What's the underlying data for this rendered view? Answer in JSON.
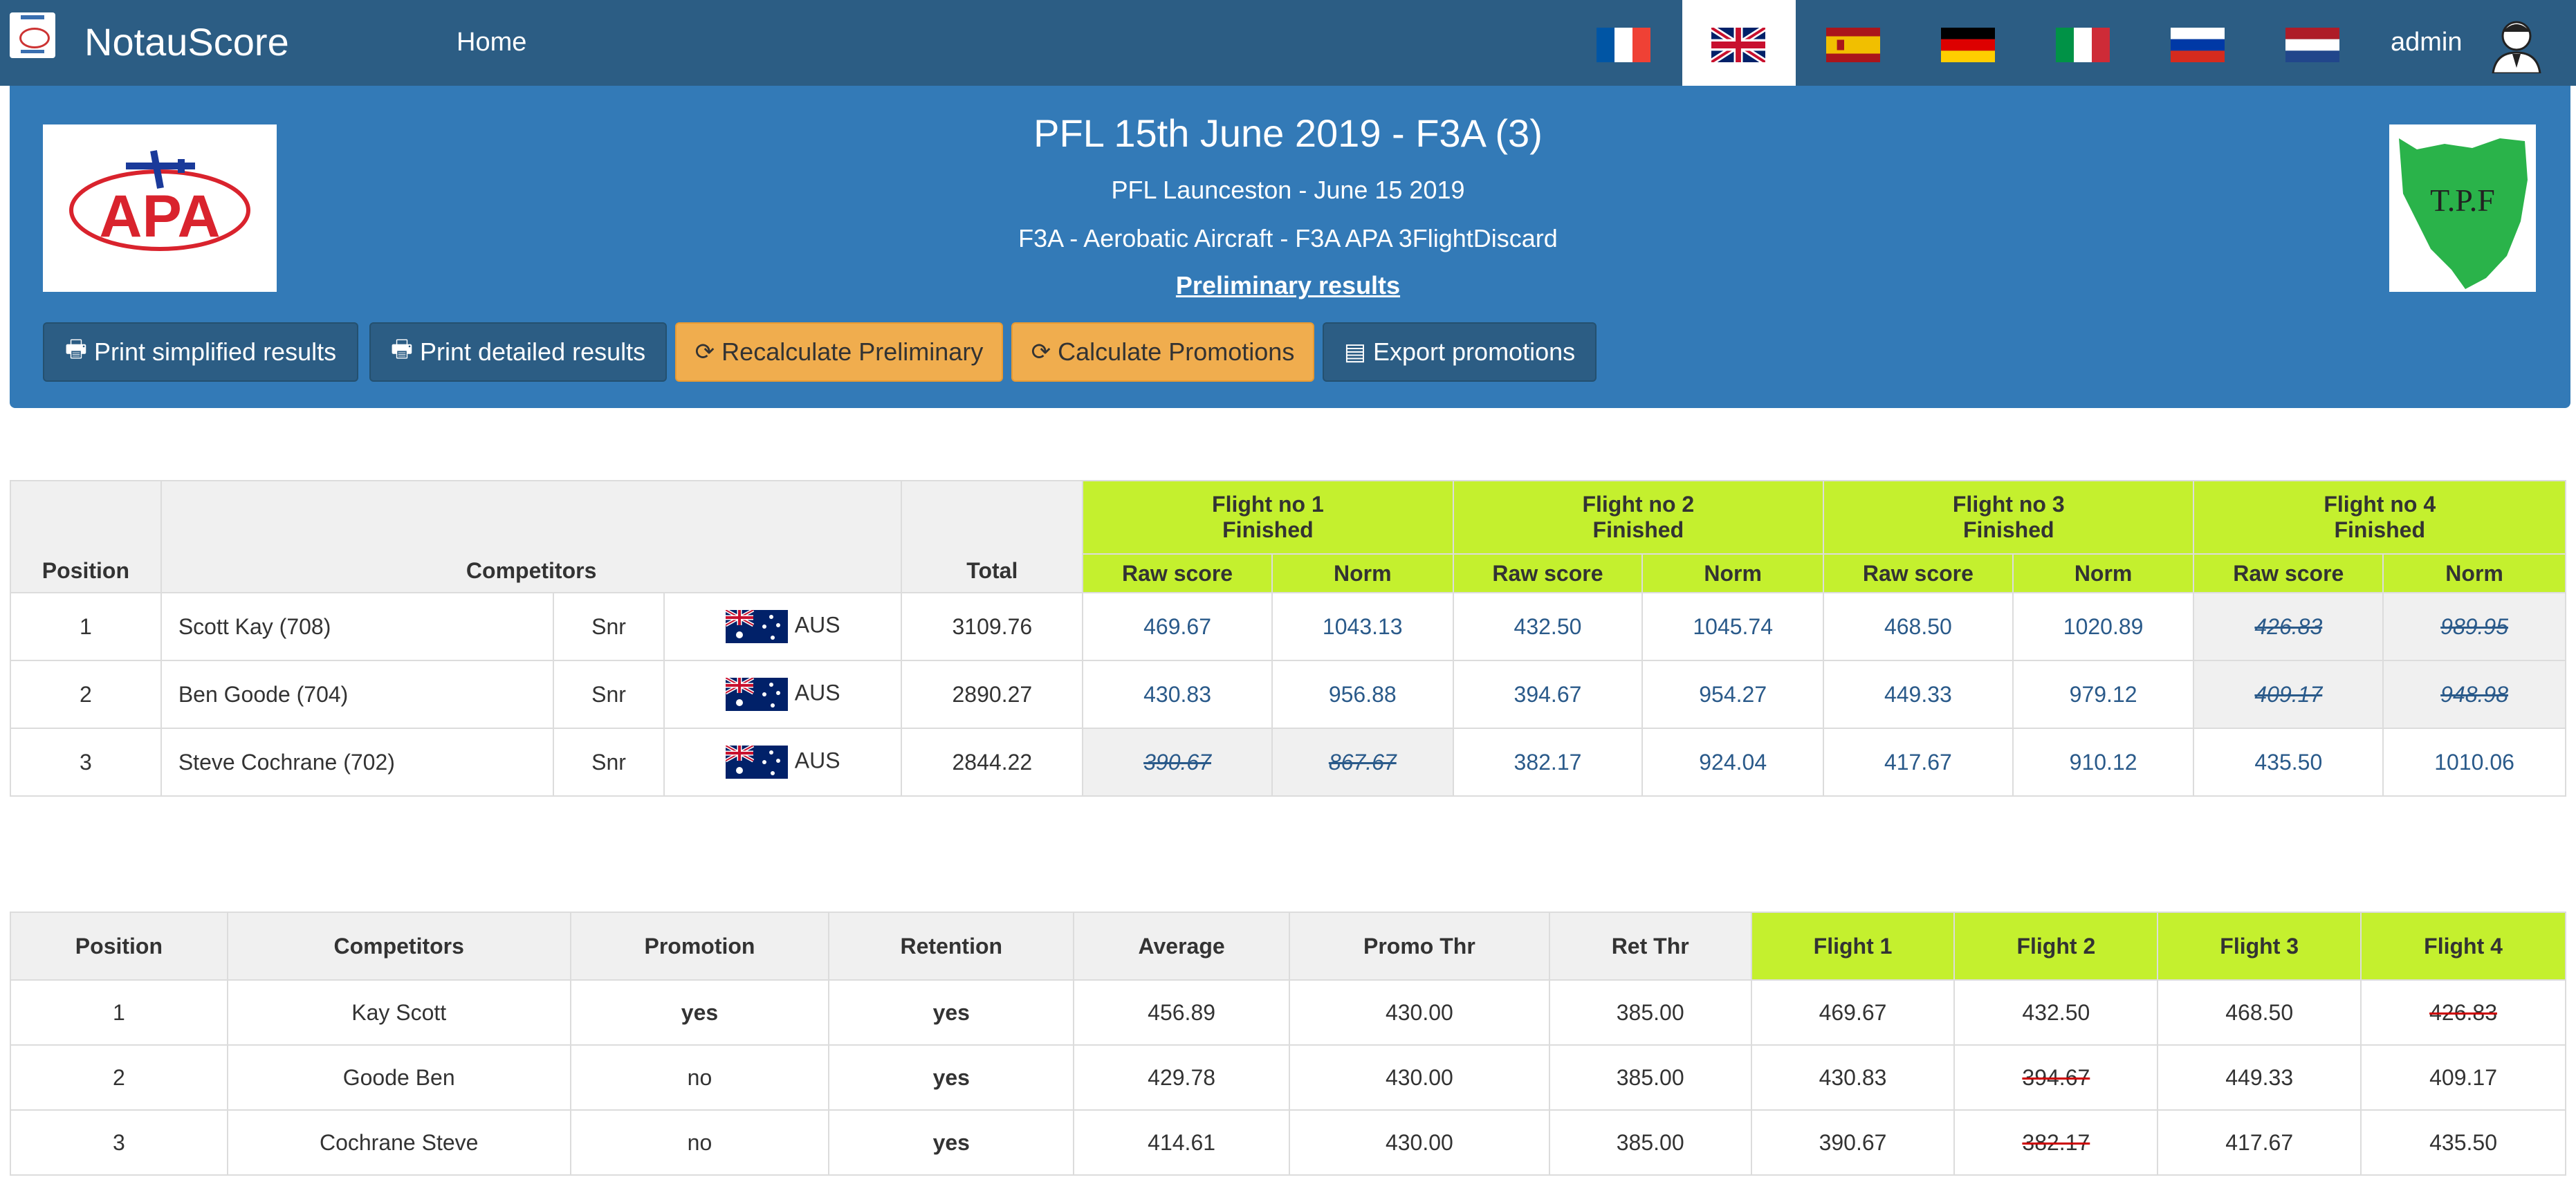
{
  "nav": {
    "brand": "NotauScore",
    "home": "Home",
    "user": "admin",
    "flags": [
      {
        "code": "fr",
        "active": false
      },
      {
        "code": "gb",
        "active": true
      },
      {
        "code": "es",
        "active": false
      },
      {
        "code": "de",
        "active": false
      },
      {
        "code": "it",
        "active": false
      },
      {
        "code": "ru",
        "active": false
      },
      {
        "code": "nl",
        "active": false
      }
    ]
  },
  "header": {
    "title": "PFL 15th June 2019 - F3A (3)",
    "subtitle1": "PFL Launceston - June 15 2019",
    "subtitle2": "F3A - Aerobatic Aircraft - F3A APA 3FlightDiscard",
    "status_link": "Preliminary results",
    "logo_left_text": "APA",
    "logo_right_text": "T.P.F",
    "buttons": {
      "print_simplified": "Print simplified results",
      "print_detailed": "Print detailed results",
      "recalc": "Recalculate Preliminary",
      "calc_promos": "Calculate Promotions",
      "export_promos": "Export promotions"
    }
  },
  "results": {
    "headers": {
      "position": "Position",
      "competitors": "Competitors",
      "total": "Total",
      "raw": "Raw score",
      "norm": "Norm",
      "f1": "Flight no 1",
      "f2": "Flight no 2",
      "f3": "Flight no 3",
      "f4": "Flight no 4",
      "finished": "Finished"
    },
    "rows": [
      {
        "pos": "1",
        "name": "Scott Kay (708)",
        "cls": "Snr",
        "country": "AUS",
        "total": "3109.76",
        "f": [
          [
            "469.67",
            "1043.13",
            false
          ],
          [
            "432.50",
            "1045.74",
            false
          ],
          [
            "468.50",
            "1020.89",
            false
          ],
          [
            "426.83",
            "989.95",
            true
          ]
        ]
      },
      {
        "pos": "2",
        "name": "Ben Goode (704)",
        "cls": "Snr",
        "country": "AUS",
        "total": "2890.27",
        "f": [
          [
            "430.83",
            "956.88",
            false
          ],
          [
            "394.67",
            "954.27",
            false
          ],
          [
            "449.33",
            "979.12",
            false
          ],
          [
            "409.17",
            "948.98",
            true
          ]
        ]
      },
      {
        "pos": "3",
        "name": "Steve Cochrane (702)",
        "cls": "Snr",
        "country": "AUS",
        "total": "2844.22",
        "f": [
          [
            "390.67",
            "867.67",
            true
          ],
          [
            "382.17",
            "924.04",
            false
          ],
          [
            "417.67",
            "910.12",
            false
          ],
          [
            "435.50",
            "1010.06",
            false
          ]
        ]
      }
    ]
  },
  "promotions": {
    "headers": [
      "Position",
      "Competitors",
      "Promotion",
      "Retention",
      "Average",
      "Promo Thr",
      "Ret Thr",
      "Flight 1",
      "Flight 2",
      "Flight 3",
      "Flight 4"
    ],
    "rows": [
      {
        "pos": "1",
        "name": "Kay Scott",
        "promo": "yes",
        "ret": "yes",
        "avg": "456.89",
        "pthr": "430.00",
        "rthr": "385.00",
        "f": [
          [
            "469.67",
            false
          ],
          [
            "432.50",
            false
          ],
          [
            "468.50",
            false
          ],
          [
            "426.83",
            true
          ]
        ]
      },
      {
        "pos": "2",
        "name": "Goode Ben",
        "promo": "no",
        "ret": "yes",
        "avg": "429.78",
        "pthr": "430.00",
        "rthr": "385.00",
        "f": [
          [
            "430.83",
            false
          ],
          [
            "394.67",
            true
          ],
          [
            "449.33",
            false
          ],
          [
            "409.17",
            false
          ]
        ]
      },
      {
        "pos": "3",
        "name": "Cochrane Steve",
        "promo": "no",
        "ret": "yes",
        "avg": "414.61",
        "pthr": "430.00",
        "rthr": "385.00",
        "f": [
          [
            "390.67",
            false
          ],
          [
            "382.17",
            true
          ],
          [
            "417.67",
            false
          ],
          [
            "435.50",
            false
          ]
        ]
      }
    ]
  }
}
